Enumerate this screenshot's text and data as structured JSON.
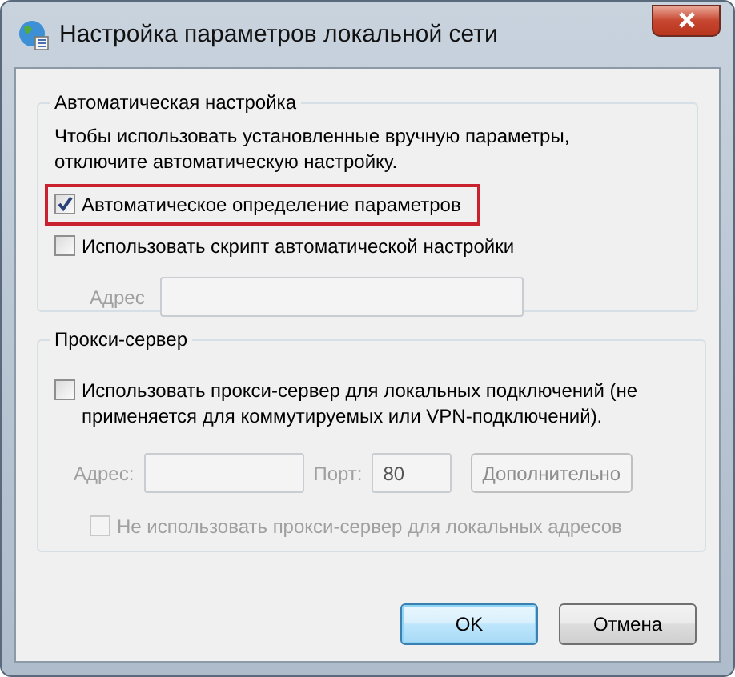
{
  "window": {
    "title": "Настройка параметров локальной сети"
  },
  "auto_config": {
    "title": "Автоматическая настройка",
    "note": "Чтобы использовать установленные вручную параметры, отключите автоматическую настройку.",
    "checkboxes": [
      {
        "label": "Автоматическое определение параметров",
        "checked": true,
        "highlighted": true
      },
      {
        "label": "Использовать скрипт автоматической настройки",
        "checked": false,
        "highlighted": false
      }
    ],
    "address": {
      "label": "Адрес",
      "disabled": true
    }
  },
  "proxy": {
    "title": "Прокси-сервер",
    "checkbox": {
      "label": "Использовать прокси-сервер для локальных подключений (не применяется для коммутируемых или VPN-подключений).",
      "checked": false
    },
    "address": {
      "label": "Адрес:",
      "disabled": true
    },
    "port": {
      "label": "Порт:",
      "value": "80",
      "disabled": true
    },
    "advanced_button": {
      "label": "Дополнительно",
      "disabled": true
    },
    "bypass": {
      "label": "Не использовать прокси-сервер для локальных адресов",
      "checked": false,
      "disabled": true
    }
  },
  "buttons": [
    {
      "label": "OK",
      "default": true
    },
    {
      "label": "Отмена",
      "default": false
    }
  ]
}
